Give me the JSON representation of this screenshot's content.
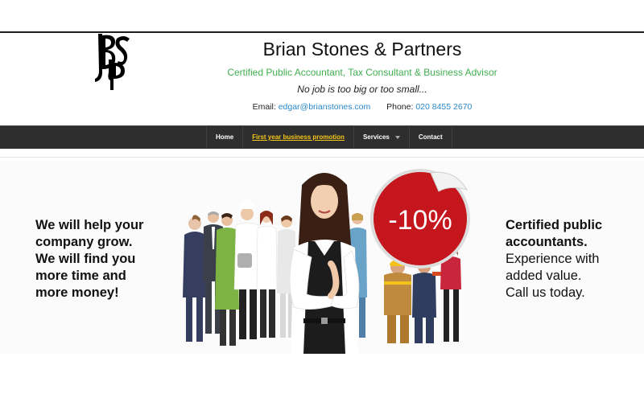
{
  "header": {
    "title": "Brian Stones & Partners",
    "tagline": "Certified Public Accountant, Tax Consultant & Business Advisor",
    "motto": "No job is too big or too small...",
    "email_label": "Email:",
    "email": "edgar@brianstones.com",
    "phone_label": "Phone:",
    "phone": "020 8455 2670"
  },
  "logo": {
    "text": "BSP"
  },
  "nav": {
    "items": [
      {
        "label": "Home"
      },
      {
        "label": "First year business promotion"
      },
      {
        "label": "Services"
      },
      {
        "label": "Contact"
      }
    ]
  },
  "banner": {
    "left_lines": [
      "We will help your",
      "company grow.",
      "We will find you",
      "more time and",
      "more money!"
    ],
    "right_lines_bold": [
      "Certified public",
      "accountants."
    ],
    "right_lines": [
      "Experience with",
      "added value.",
      "Call us today."
    ],
    "discount": "-10%"
  },
  "colors": {
    "nav_bg": "#2e2e2e",
    "promo_link": "#f5c518",
    "tagline": "#3fae4f",
    "link": "#2a88c8",
    "badge": "#c4161c"
  }
}
